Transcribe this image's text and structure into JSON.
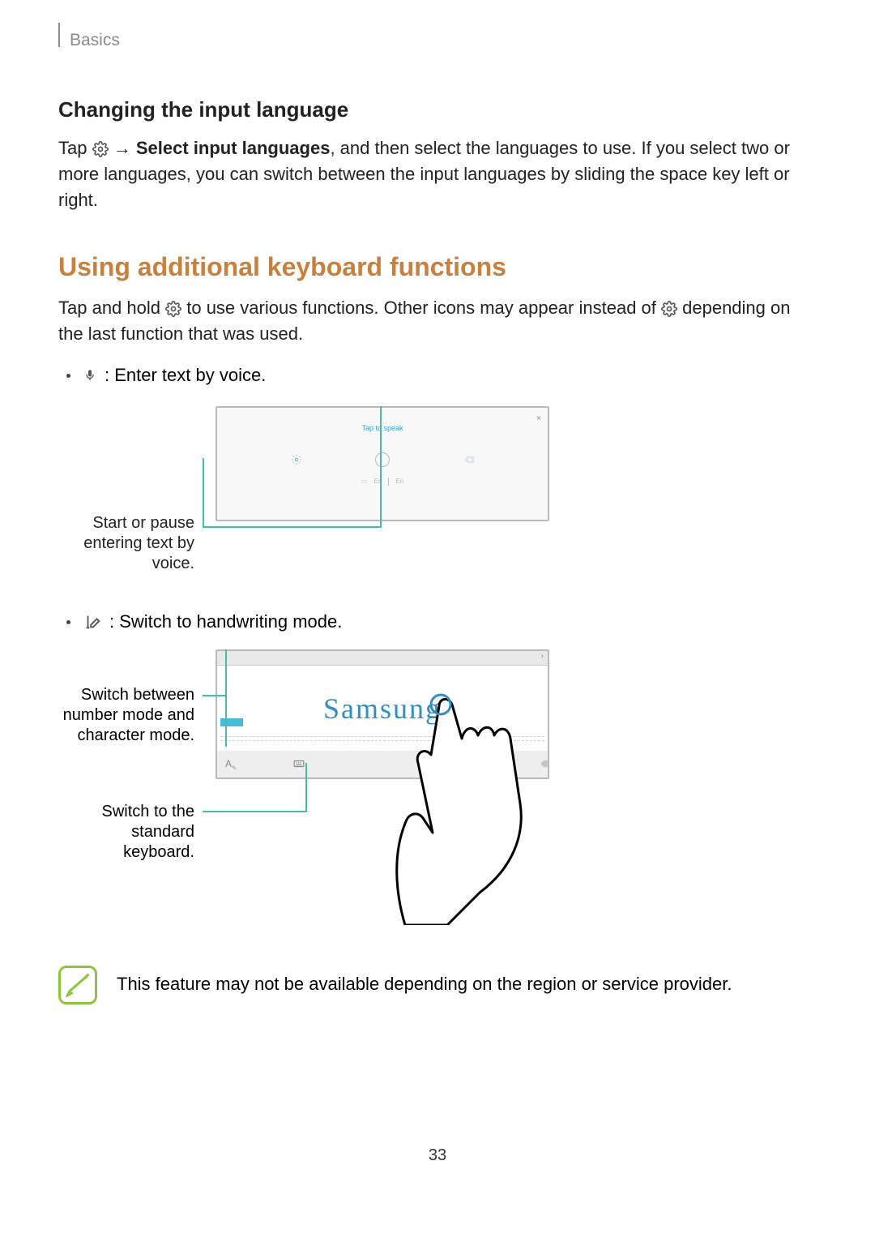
{
  "header": {
    "section": "Basics"
  },
  "sub1": {
    "title": "Changing the input language",
    "p1_a": "Tap ",
    "p1_b": " → ",
    "p1_bold": "Select input languages",
    "p1_c": ", and then select the languages to use. If you select two or more languages, you can switch between the input languages by sliding the space key left or right."
  },
  "sec2": {
    "title": "Using additional keyboard functions",
    "p1_a": "Tap and hold ",
    "p1_b": " to use various functions. Other icons may appear instead of ",
    "p1_c": " depending on the last function that was used.",
    "bullet_voice": " : Enter text by voice.",
    "bullet_hand": " : Switch to handwriting mode."
  },
  "fig1": {
    "tap_speak": "Tap to speak",
    "callout": "Start or pause entering text by voice."
  },
  "fig2": {
    "word": "Samsung",
    "callout_a": "Switch between number mode and character mode.",
    "callout_b": "Switch to the standard keyboard."
  },
  "note": {
    "text": "This feature may not be available depending on the region or service provider."
  },
  "page_number": "33"
}
